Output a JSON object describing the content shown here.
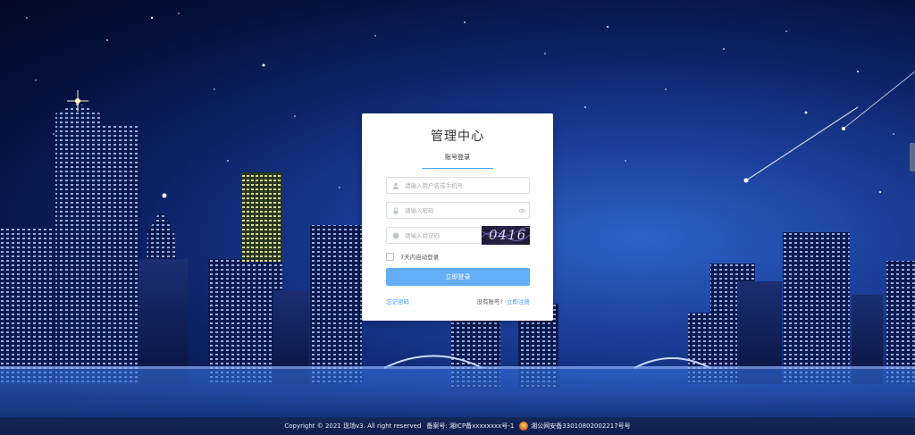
{
  "login": {
    "title": "管理中心",
    "tab_label": "账号登录",
    "username_placeholder": "请输入用户名或手机号",
    "password_placeholder": "请输入密码",
    "code_placeholder": "请输入验证码",
    "captcha_text": "0416",
    "remember_label": "7天内自动登录",
    "login_button": "立即登录",
    "forgot_link": "忘记密码",
    "no_account_text": "没有账号?",
    "register_link": "立即注册"
  },
  "footer": {
    "copyright": "Copyright © 2021 现场v3. All right reserved",
    "icp": "备案号: 湘ICP备xxxxxxxx号-1",
    "police": "湘公网安备33010802002217号号"
  },
  "icons": {
    "user": "user-icon",
    "lock": "lock-icon",
    "eye": "eye-icon",
    "code": "shield-icon",
    "badge": "police-badge-icon"
  }
}
